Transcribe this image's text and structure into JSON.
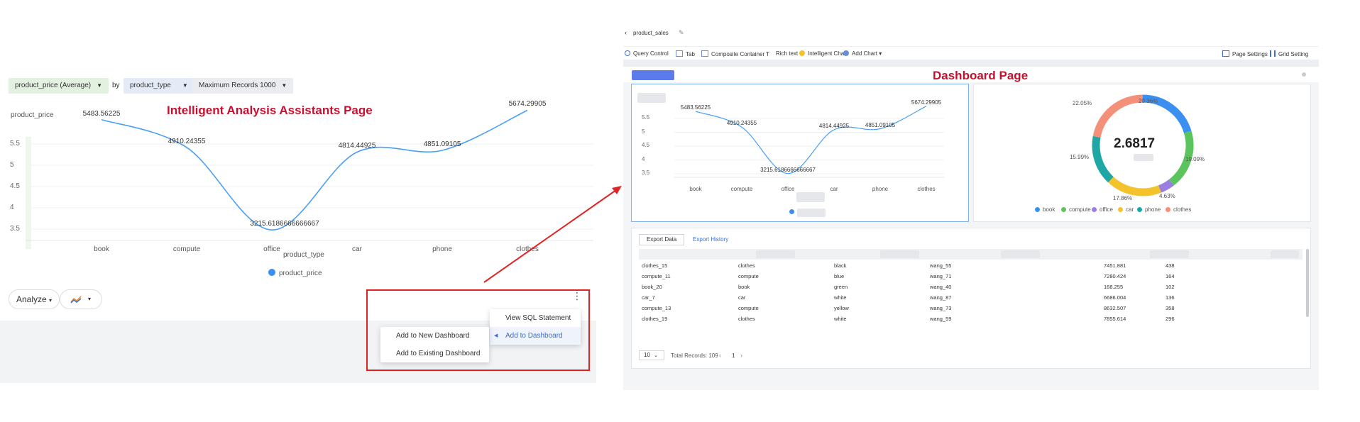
{
  "left": {
    "title": "Intelligent Analysis Assistants Page",
    "controls": {
      "measure": "product_price (Average)",
      "by": "by",
      "dimension": "product_type",
      "max_records": "Maximum Records 1000"
    },
    "y_axis_label": "product_price",
    "x_axis_label": "product_type",
    "legend": "product_price",
    "analyze_label": "Analyze",
    "menu": {
      "primary": [
        "View SQL Statement",
        "Add to Dashboard"
      ],
      "secondary": [
        "Add to New Dashboard",
        "Add to Existing Dashboard"
      ]
    }
  },
  "right": {
    "page_name": "product_sales",
    "title": "Dashboard Page",
    "toolbar": [
      "Query Control",
      "Tab",
      "Composite Container",
      "Rich text",
      "Intelligent Chart",
      "Add Chart"
    ],
    "toolbar_right": [
      "Page Settings",
      "Grid Setting"
    ],
    "donut": {
      "center_value": "2.6817",
      "slices": [
        {
          "label": "book",
          "percent": "20.36%",
          "value": 20.36,
          "color": "#3b8ff0"
        },
        {
          "label": "compute",
          "percent": "19.09%",
          "value": 19.09,
          "color": "#5bc45c"
        },
        {
          "label": "office",
          "percent": "4.63%",
          "value": 4.63,
          "color": "#9b7fe0"
        },
        {
          "label": "car",
          "percent": "17.86%",
          "value": 17.86,
          "color": "#f4c22b"
        },
        {
          "label": "phone",
          "percent": "15.99%",
          "value": 15.99,
          "color": "#1fa7a5"
        },
        {
          "label": "clothes",
          "percent": "22.05%",
          "value": 22.05,
          "color": "#f4907a"
        }
      ]
    },
    "table": {
      "tabs": [
        "Export Data",
        "Export History"
      ],
      "rows": [
        [
          "clothes_15",
          "clothes",
          "black",
          "wang_55",
          "7451.881",
          "438"
        ],
        [
          "compute_11",
          "compute",
          "blue",
          "wang_71",
          "7280.424",
          "164"
        ],
        [
          "book_20",
          "book",
          "green",
          "wang_40",
          "168.255",
          "102"
        ],
        [
          "car_7",
          "car",
          "white",
          "wang_87",
          "6686.004",
          "136"
        ],
        [
          "compute_13",
          "compute",
          "yellow",
          "wang_73",
          "8632.507",
          "358"
        ],
        [
          "clothes_19",
          "clothes",
          "white",
          "wang_59",
          "7855.614",
          "296"
        ]
      ],
      "page_size": "10",
      "total": "Total Records: 109",
      "current_page": "1"
    }
  },
  "chart_data": [
    {
      "type": "line",
      "categories": [
        "book",
        "compute",
        "office",
        "car",
        "phone",
        "clothes"
      ],
      "series": [
        {
          "name": "product_price",
          "values": [
            5483.56225,
            4910.24355,
            3215.6186666666667,
            4814.44925,
            4851.09105,
            5674.29905
          ]
        }
      ],
      "labels": [
        "5483.56225",
        "4910.24355",
        "3215.6186666666667",
        "4814.44925",
        "4851.09105",
        "5674.29905"
      ],
      "title": "",
      "xlabel": "product_type",
      "ylabel": "product_price",
      "ytick_labels": [
        "5.5",
        "5",
        "4.5",
        "4",
        "3.5"
      ],
      "ylim": [
        3000,
        5900
      ]
    },
    {
      "type": "line",
      "categories": [
        "book",
        "compute",
        "office",
        "car",
        "phone",
        "clothes"
      ],
      "series": [
        {
          "values": [
            5483.56225,
            4910.24355,
            3215.6186666666667,
            4814.44925,
            4851.09105,
            5674.29905
          ]
        }
      ],
      "labels": [
        "5483.56225",
        "4910.24355",
        "3215.6186666666667",
        "4814.44925",
        "4851.09105",
        "5674.29905"
      ],
      "ytick_labels": [
        "5.5",
        "5",
        "4.5",
        "4",
        "3.5"
      ],
      "ylim": [
        3000,
        5900
      ]
    },
    {
      "type": "pie",
      "categories": [
        "book",
        "compute",
        "office",
        "car",
        "phone",
        "clothes"
      ],
      "values": [
        20.36,
        19.09,
        4.63,
        17.86,
        15.99,
        22.05
      ]
    }
  ]
}
